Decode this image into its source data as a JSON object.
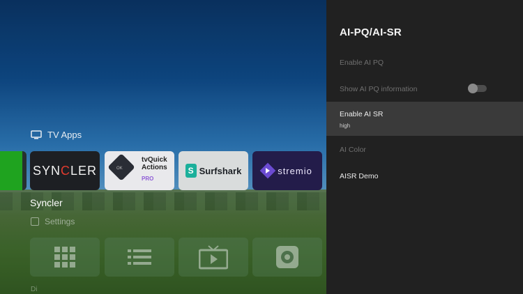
{
  "launcher": {
    "row_title": "TV Apps",
    "apps": [
      {
        "name": "Syncler",
        "logo_text_a": "SYN",
        "logo_text_c": "C",
        "logo_text_b": "LER"
      },
      {
        "name": "tvQuick Actions PRO",
        "line1": "tvQuick Actions",
        "line2": "PRO",
        "badge": "OK"
      },
      {
        "name": "Surfshark",
        "logo_letter": "S",
        "label": "Surfshark"
      },
      {
        "name": "Stremio",
        "label": "stremio"
      }
    ],
    "focused_app_name": "Syncler",
    "settings_label": "Settings",
    "actions": [
      "apps-grid-icon",
      "list-icon",
      "tv-play-icon",
      "settings-gear-icon"
    ],
    "bottom_partial": "Di"
  },
  "panel": {
    "title": "AI-PQ/AI-SR",
    "items": [
      {
        "label": "Enable AI PQ",
        "enabled": false
      },
      {
        "label": "Show AI PQ information",
        "enabled": false,
        "toggle": "off"
      },
      {
        "label": "Enable AI SR",
        "value": "high",
        "selected": true
      },
      {
        "label": "AI Color",
        "enabled": false
      },
      {
        "label": "AISR Demo",
        "enabled": true
      }
    ]
  },
  "colors": {
    "panel_bg": "#212121",
    "selected_bg": "#3a3a3a",
    "accent_green": "#1fa31f"
  }
}
